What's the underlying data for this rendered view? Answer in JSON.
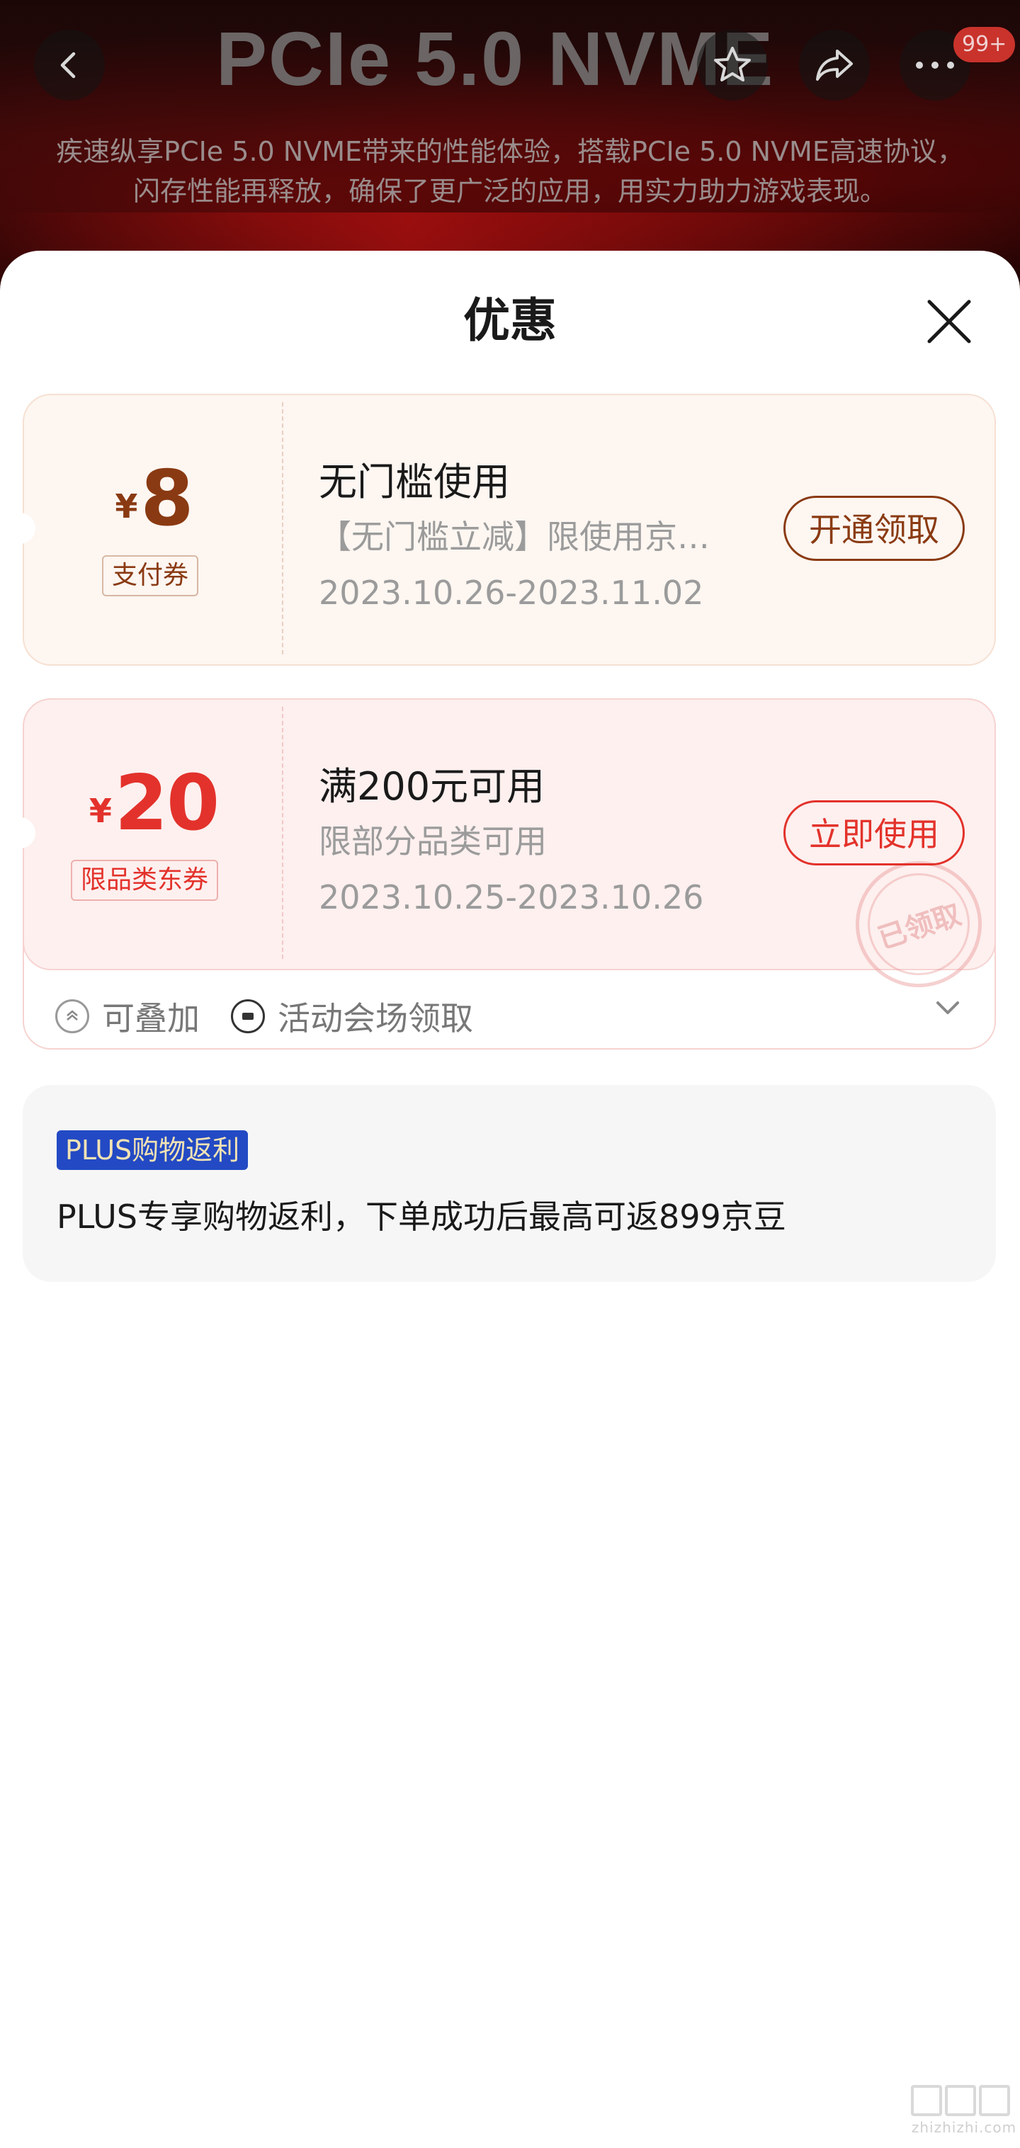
{
  "banner": {
    "title": "PCIe 5.0 NVME",
    "description_line1": "疾速纵享PCIe 5.0 NVME带来的性能体验，搭载PCIe 5.0 NVME高速协议，",
    "description_line2": "闪存性能再释放，确保了更广泛的应用，用实力助力游戏表现。",
    "cart_badge": "99+"
  },
  "sheet": {
    "title": "优惠"
  },
  "coupons": [
    {
      "currency": "¥",
      "amount": "8",
      "tag": "支付券",
      "title": "无门槛使用",
      "description": "【无门槛立减】限使用京…",
      "date_range": "2023.10.26-2023.11.02",
      "button": "开通领取",
      "accent_color": "#8a3a12"
    },
    {
      "currency": "¥",
      "amount": "20",
      "tag": "限品类东券",
      "title": "满200元可用",
      "description": "限部分品类可用",
      "date_range": "2023.10.25-2023.10.26",
      "button": "立即使用",
      "stamp": "已领取",
      "accent_color": "#e3322b",
      "footer": {
        "stackable": "可叠加",
        "source": "活动会场领取"
      }
    }
  ],
  "plus": {
    "tag": "PLUS购物返利",
    "text": "PLUS专享购物返利，下单成功后最高可返899京豆",
    "tag_color": "#234ac4"
  },
  "watermark": {
    "text": "zhizhizhi.com"
  }
}
